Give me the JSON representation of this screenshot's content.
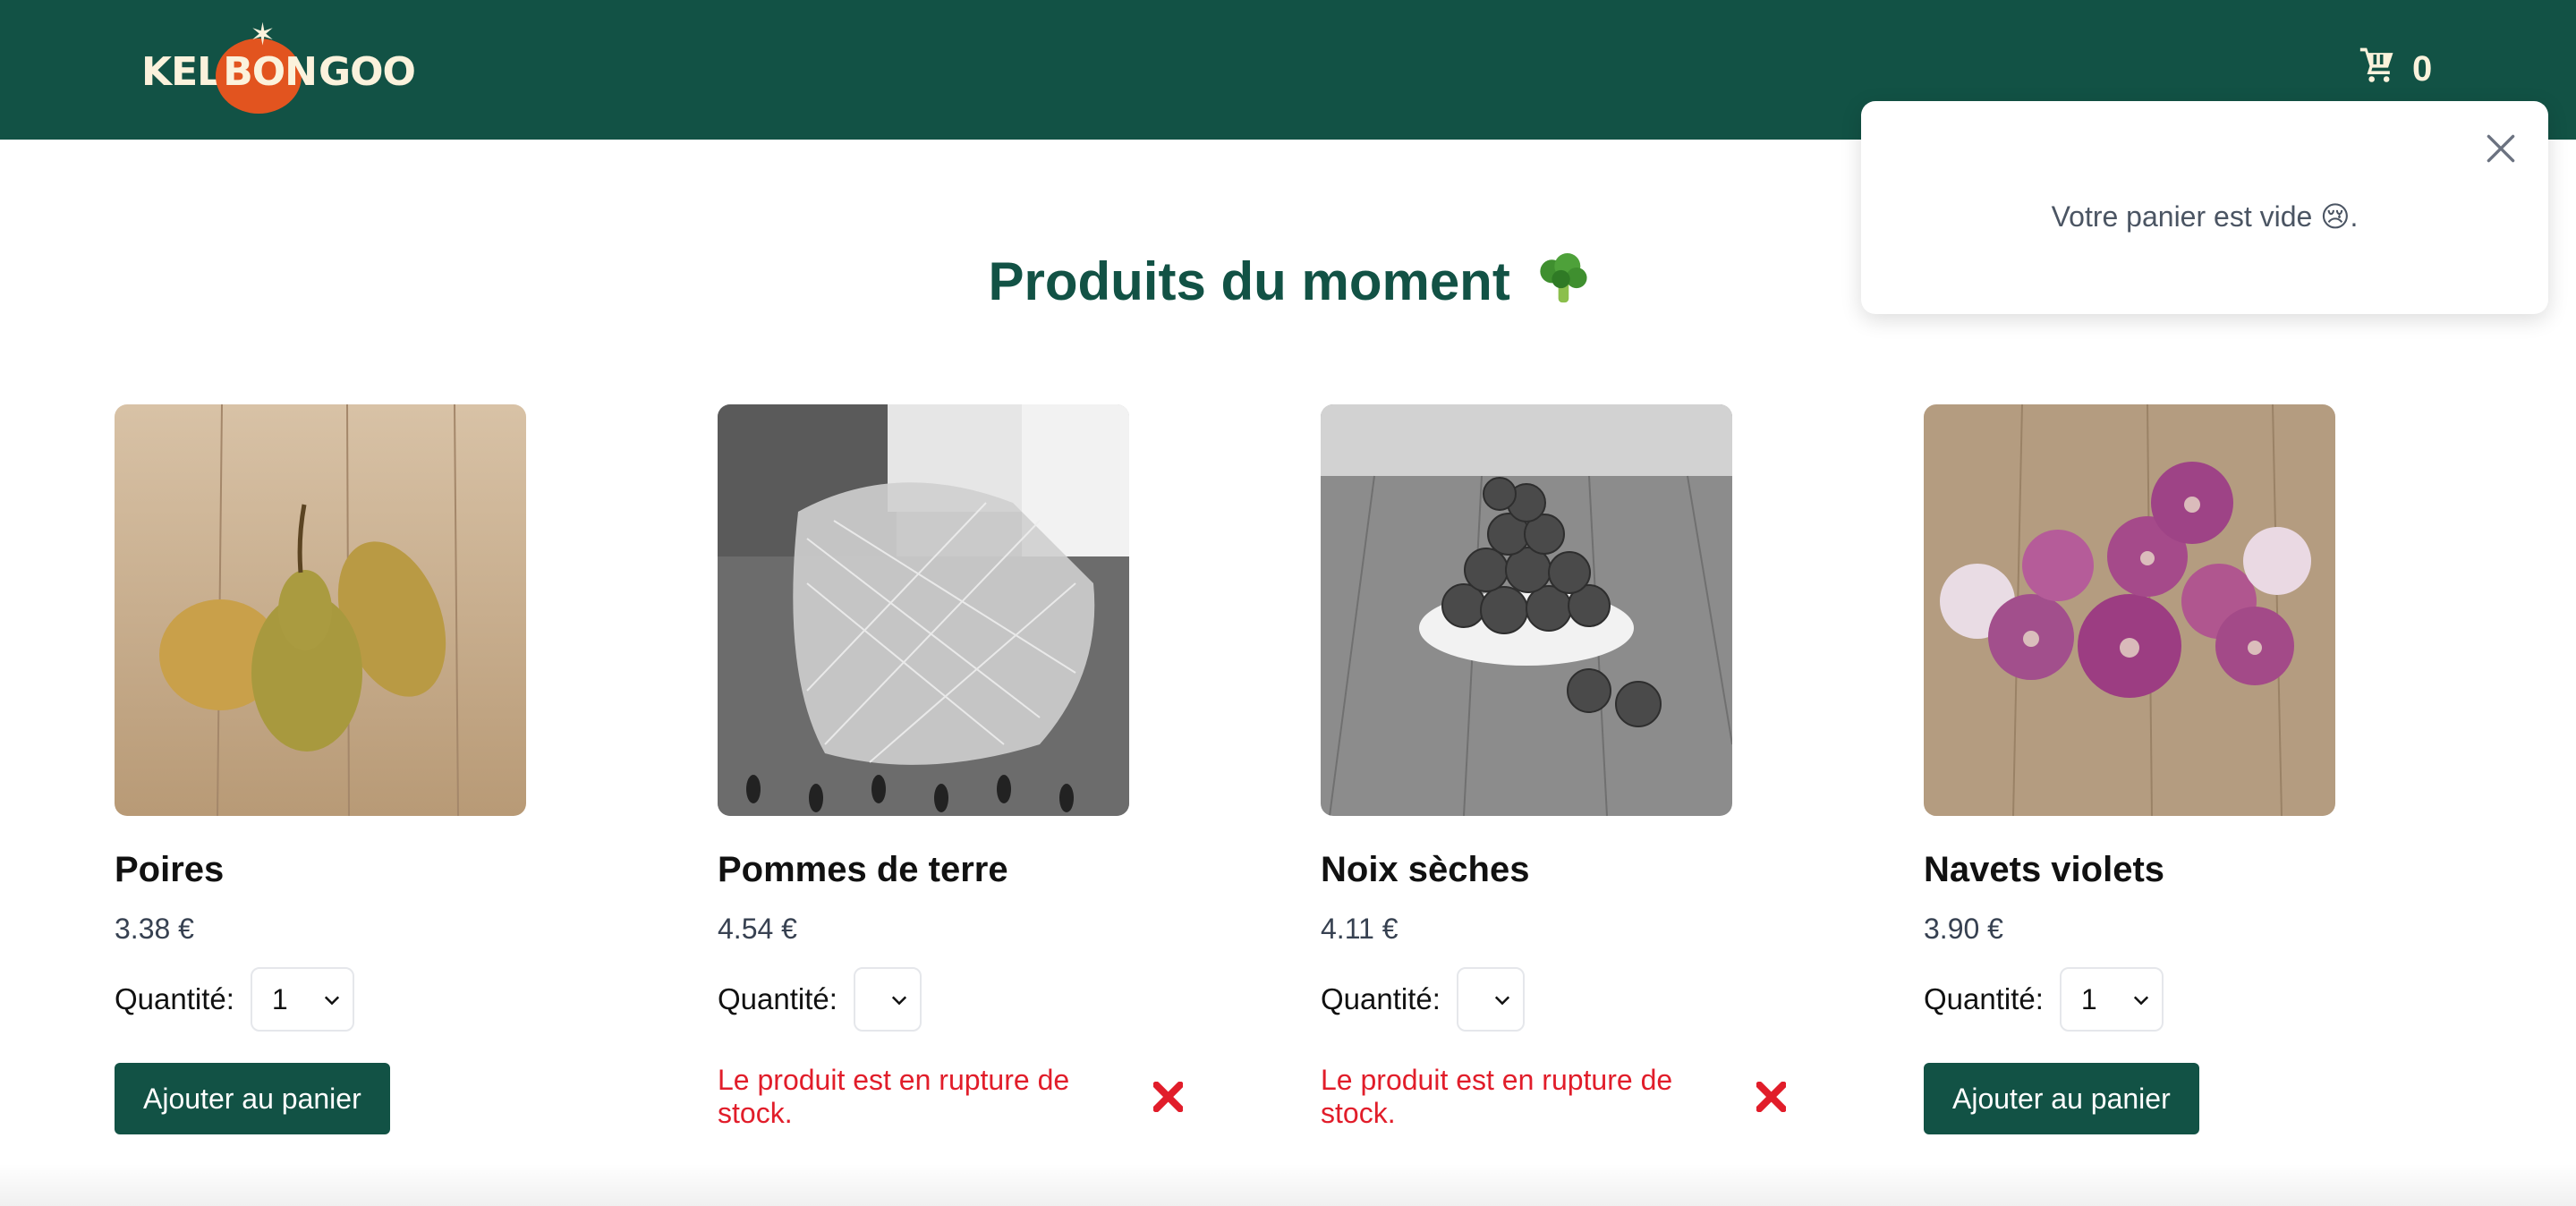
{
  "header": {
    "logo": {
      "part1": "KEL",
      "part2": "BON",
      "part3": "GOO"
    },
    "cart_count": "0",
    "background_color": "#125245"
  },
  "title": {
    "text": "Produits du moment",
    "emoji_icon": "broccoli-icon"
  },
  "cart_popup": {
    "message": "Votre panier est vide 😢.",
    "close_icon": "close-icon"
  },
  "quantity_label": "Quantité:",
  "products": [
    {
      "name": "Poires",
      "price": "3.38 €",
      "quantity": "1",
      "in_stock": true,
      "button_label": "Ajouter au panier"
    },
    {
      "name": "Pommes de terre",
      "price": "4.54 €",
      "quantity": "",
      "in_stock": false,
      "out_of_stock_text": "Le produit est en rupture de stock."
    },
    {
      "name": "Noix sèches",
      "price": "4.11 €",
      "quantity": "",
      "in_stock": false,
      "out_of_stock_text": "Le produit est en rupture de stock."
    },
    {
      "name": "Navets violets",
      "price": "3.90 €",
      "quantity": "1",
      "in_stock": true,
      "button_label": "Ajouter au panier"
    }
  ],
  "colors": {
    "brand_green": "#125245",
    "error_red": "#e11d2a",
    "logo_tomato": "#e2541f"
  }
}
